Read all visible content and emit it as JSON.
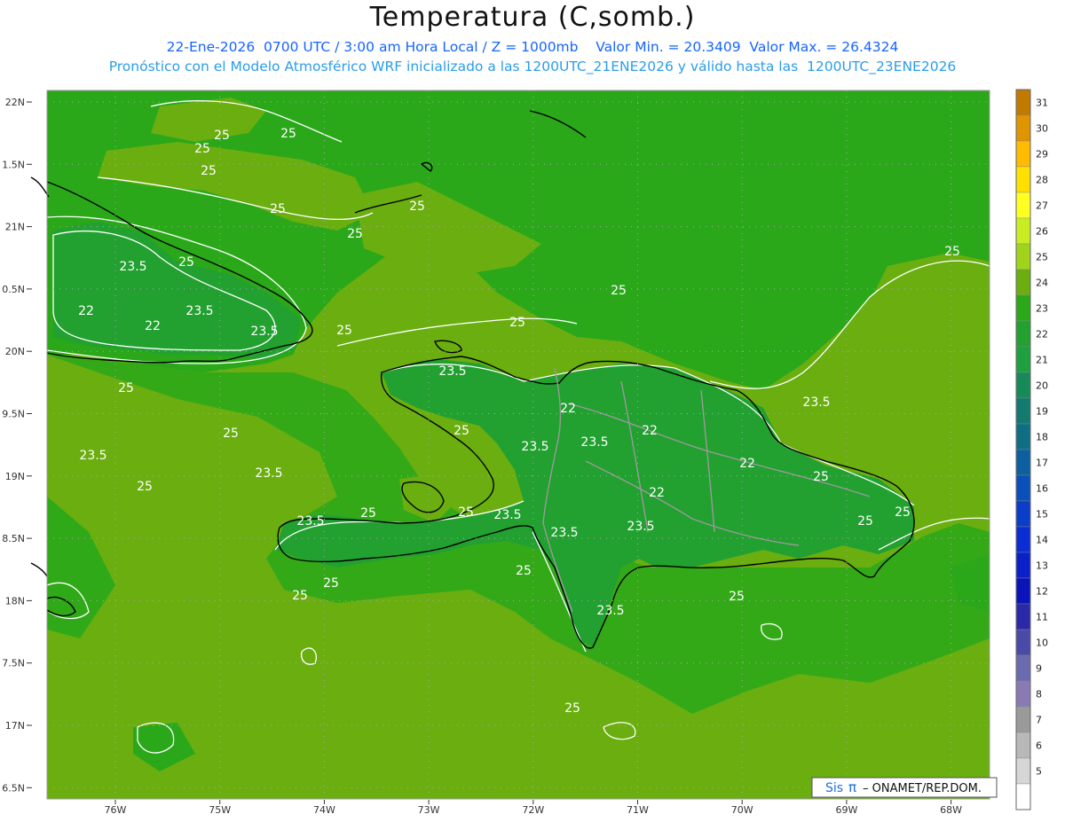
{
  "header": {
    "title": "Temperatura (C,somb.)",
    "line1": "22-Ene-2026  0700 UTC / 3:00 am Hora Local / Z = 1000mb    Valor Min. = 20.3409  Valor Max. = 26.4324",
    "line2": "Pronóstico con el Modelo Atmosférico WRF inicializado a las 1200UTC_21ENE2026 y válido hasta las  1200UTC_23ENE2026"
  },
  "axes": {
    "lat_labels": [
      "22N",
      "1.5N",
      "21N",
      "0.5N",
      "20N",
      "9.5N",
      "19N",
      "8.5N",
      "18N",
      "7.5N",
      "17N",
      "6.5N"
    ],
    "lon_labels": [
      "76W",
      "75W",
      "74W",
      "73W",
      "72W",
      "71W",
      "70W",
      "69W",
      "68W"
    ]
  },
  "colorbar": {
    "levels": [
      "31",
      "30",
      "29",
      "28",
      "27",
      "26",
      "25",
      "24",
      "23",
      "22",
      "21",
      "20",
      "19",
      "18",
      "17",
      "16",
      "15",
      "14",
      "13",
      "12",
      "11",
      "10",
      "9",
      "8",
      "7",
      "6",
      "5"
    ],
    "colors": [
      "#c07a00",
      "#e09400",
      "#ffbb00",
      "#ffe000",
      "#ffff22",
      "#c8ee22",
      "#a0d41a",
      "#6aae10",
      "#2aa81a",
      "#22a030",
      "#1ea040",
      "#178a5a",
      "#127a6e",
      "#0f6e84",
      "#0d60a0",
      "#0a50b8",
      "#0a3ec8",
      "#0a2ed4",
      "#0a20c8",
      "#0a14b8",
      "#2a2aa8",
      "#4a4aa8",
      "#6a6aae",
      "#8a7ab4",
      "#9a9a9a",
      "#b8b8b8",
      "#d6d6d6",
      "#ffffff"
    ]
  },
  "contour_labels": [
    "25",
    "25",
    "25",
    "25",
    "25",
    "23.5",
    "25",
    "22",
    "23.5",
    "22",
    "23.5",
    "25",
    "25",
    "25",
    "25",
    "25",
    "25",
    "23.5",
    "22",
    "25",
    "22",
    "23.5",
    "23.5",
    "22",
    "22",
    "25",
    "23.5",
    "25",
    "23.5",
    "25",
    "23.5",
    "23.5",
    "25",
    "25",
    "23.5",
    "23.5",
    "23.5",
    "25",
    "25",
    "25",
    "25",
    "25",
    "25",
    "23.5",
    "25",
    "25"
  ],
  "credit": {
    "sis": "Sis",
    "pi": "π",
    "rest": "– ONAMET/REP.DOM."
  },
  "colors": {
    "field_25": "#6aae10",
    "field_24": "#2aa81a",
    "field_23": "#22a030",
    "contour": "#ffffff",
    "coast": "#000000",
    "border": "#9a9a9a",
    "grid": "#a8a8a8"
  }
}
